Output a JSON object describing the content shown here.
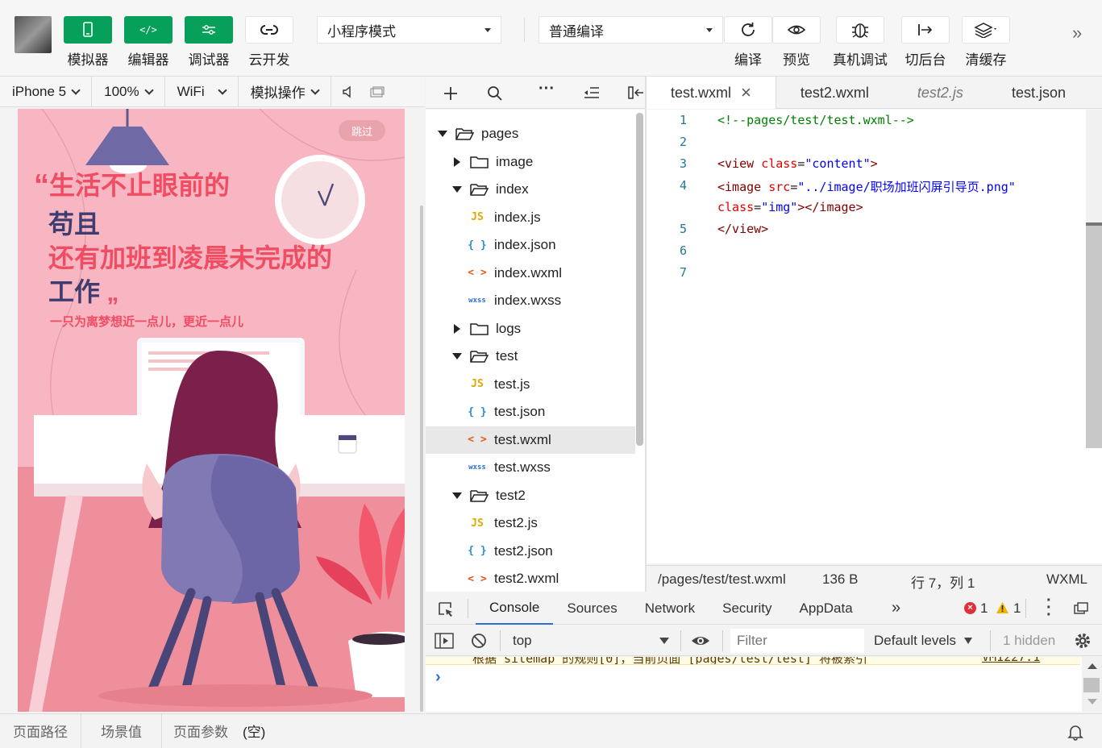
{
  "toolbar": {
    "buttons": [
      "模拟器",
      "编辑器",
      "调试器",
      "云开发"
    ],
    "mode_select": "小程序模式",
    "compile_select": "普通编译",
    "right_buttons": [
      "编译",
      "预览",
      "真机调试",
      "切后台",
      "清缓存"
    ]
  },
  "simbar": {
    "device": "iPhone 5",
    "zoom": "100%",
    "network": "WiFi",
    "operate": "模拟操作"
  },
  "phone": {
    "skip": "跳过",
    "headline_line1": "生活不止眼前的",
    "headline_line2": "苟且",
    "headline_line3": "还有加班到凌晨未完成的",
    "headline_line4": "工作",
    "subline": "一只为离梦想近一点儿，更近一点儿"
  },
  "sim_bottom": {
    "path": "页面路径",
    "scene": "场景值",
    "params": "页面参数",
    "params_value": "(空)"
  },
  "tree": [
    {
      "type": "folder-open",
      "label": "pages",
      "indent": 0,
      "arrow": "down"
    },
    {
      "type": "folder",
      "label": "image",
      "indent": 1,
      "arrow": "right"
    },
    {
      "type": "folder-open",
      "label": "index",
      "indent": 1,
      "arrow": "down"
    },
    {
      "type": "js",
      "label": "index.js",
      "indent": 2
    },
    {
      "type": "json",
      "label": "index.json",
      "indent": 2
    },
    {
      "type": "wxml",
      "label": "index.wxml",
      "indent": 2
    },
    {
      "type": "wxss",
      "label": "index.wxss",
      "indent": 2
    },
    {
      "type": "folder",
      "label": "logs",
      "indent": 1,
      "arrow": "right"
    },
    {
      "type": "folder-open",
      "label": "test",
      "indent": 1,
      "arrow": "down"
    },
    {
      "type": "js",
      "label": "test.js",
      "indent": 2
    },
    {
      "type": "json",
      "label": "test.json",
      "indent": 2
    },
    {
      "type": "wxml",
      "label": "test.wxml",
      "indent": 2,
      "selected": true
    },
    {
      "type": "wxss",
      "label": "test.wxss",
      "indent": 2
    },
    {
      "type": "folder-open",
      "label": "test2",
      "indent": 1,
      "arrow": "down"
    },
    {
      "type": "js",
      "label": "test2.js",
      "indent": 2
    },
    {
      "type": "json",
      "label": "test2.json",
      "indent": 2
    },
    {
      "type": "wxml",
      "label": "test2.wxml",
      "indent": 2
    }
  ],
  "tabs": [
    {
      "label": "test.wxml",
      "active": true,
      "close": "×"
    },
    {
      "label": "test2.wxml"
    },
    {
      "label": "test2.js",
      "italic": true
    },
    {
      "label": "test.json"
    }
  ],
  "editor_lines": [
    {
      "n": "1",
      "html": "<span style=\"color:#008000\">&lt;!--pages/test/test.wxml--&gt;</span>"
    },
    {
      "n": "2",
      "html": ""
    },
    {
      "n": "3",
      "html": "&lt;view <span style=\"color:#e50000\">class</span><span style=\"color:#222\">=</span><span style=\"color:#0000ff\">\"content\"</span>&gt;"
    },
    {
      "n": "4",
      "html": "&lt;image <span style=\"color:#e50000\">src</span><span style=\"color:#222\">=</span><span style=\"color:#0000ff\">\"../image/职场加班闪屏引导页.png\"</span>"
    },
    {
      "n": "",
      "html": "<span style=\"color:#e50000\">class</span><span style=\"color:#222\">=</span><span style=\"color:#0000ff\">\"img\"</span>&gt;&lt;/image&gt;"
    },
    {
      "n": "5",
      "html": "&lt;/view&gt;"
    },
    {
      "n": "6",
      "html": ""
    },
    {
      "n": "7",
      "html": ""
    }
  ],
  "status": {
    "path": "/pages/test/test.wxml",
    "size": "136 B",
    "pos": "行 7，列 1",
    "lang": "WXML"
  },
  "devtools": {
    "tabs": [
      "Console",
      "Sources",
      "Network",
      "Security",
      "AppData"
    ],
    "errors": "1",
    "warnings": "1",
    "context": "top",
    "filter_placeholder": "Filter",
    "levels": "Default levels",
    "hidden": "1 hidden",
    "log_text": "根据 sitemap 的规则[0]，当前页面 [pages/test/test] 将被索引",
    "log_link": "VM1227:1",
    "prompt": "›"
  }
}
